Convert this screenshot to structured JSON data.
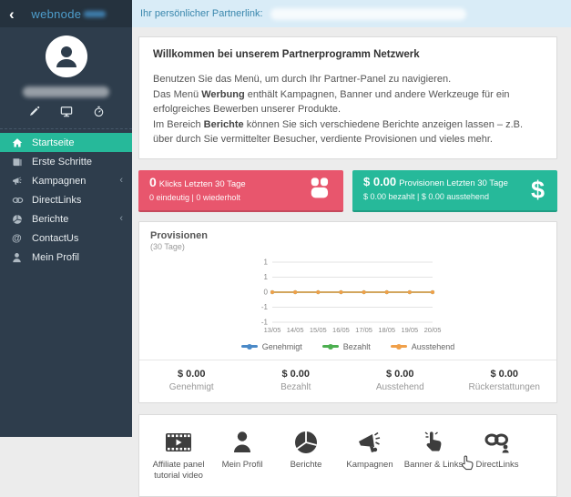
{
  "sidebar": {
    "back_arrow": "‹",
    "logo_text": "webnode",
    "menu": [
      {
        "label": "Startseite",
        "icon": "home-icon",
        "active": true
      },
      {
        "label": "Erste Schritte",
        "icon": "book-icon"
      },
      {
        "label": "Kampagnen",
        "icon": "megaphone-icon",
        "chevron": "‹"
      },
      {
        "label": "DirectLinks",
        "icon": "link-icon"
      },
      {
        "label": "Berichte",
        "icon": "pie-chart-icon",
        "chevron": "‹"
      },
      {
        "label": "ContactUs",
        "icon": "at-icon"
      },
      {
        "label": "Mein Profil",
        "icon": "user-icon"
      }
    ],
    "quick_icons": [
      "edit-pencil-icon",
      "monitor-icon",
      "stopwatch-icon"
    ],
    "colors": {
      "background": "#2e3d4c",
      "top_strip": "#25323e",
      "active_item": "#26b99a"
    }
  },
  "header": {
    "partnerlink_label": "Ihr persönlicher Partnerlink:",
    "bar_color": "#d9ecf7"
  },
  "welcome": {
    "title": "Willkommen bei unserem Partnerprogramm Netzwerk",
    "line1": "Benutzen Sie das Menü, um durch Ihr Partner-Panel zu navigieren.",
    "line2_pre": "Das Menü ",
    "line2_bold": "Werbung",
    "line2_post": " enthält Kampagnen, Banner und andere Werkzeuge für ein erfolgreiches Bewerben unserer Produkte.",
    "line3_pre": "Im Bereich ",
    "line3_bold": "Berichte",
    "line3_post": " können Sie sich verschiedene Berichte anzeigen lassen – z.B. über durch Sie vermittelter Besucher, verdiente Provisionen und vieles mehr."
  },
  "tiles": {
    "clicks": {
      "value": "0",
      "label": "Klicks Letzten 30 Tage",
      "sub": "0 eindeutig | 0 wiederholt",
      "color": "#e8566d",
      "icon": "mouse-icon"
    },
    "provisions": {
      "value": "$ 0.00",
      "label": "Provisionen Letzten 30 Tage",
      "sub": "$ 0.00 bezahlt | $ 0.00 ausstehend",
      "color": "#26b99a",
      "icon": "dollar-icon"
    }
  },
  "chart_data": {
    "type": "line",
    "title": "Provisionen",
    "subtitle": "(30 Tage)",
    "categories": [
      "13/05",
      "14/05",
      "15/05",
      "16/05",
      "17/05",
      "18/05",
      "19/05",
      "20/05"
    ],
    "series": [
      {
        "name": "Genehmigt",
        "color": "#4a89c7",
        "values": [
          0,
          0,
          0,
          0,
          0,
          0,
          0,
          0
        ]
      },
      {
        "name": "Bezahlt",
        "color": "#4caf50",
        "values": [
          0,
          0,
          0,
          0,
          0,
          0,
          0,
          0
        ]
      },
      {
        "name": "Ausstehend",
        "color": "#f0a04a",
        "values": [
          0,
          0,
          0,
          0,
          0,
          0,
          0,
          0
        ]
      }
    ],
    "y_tick_labels": [
      "1",
      "1",
      "0",
      "-1",
      "-1"
    ],
    "ylim": [
      -1,
      1
    ],
    "grid": true,
    "legend_position": "bottom"
  },
  "chart_stats": [
    {
      "value": "$ 0.00",
      "label": "Genehmigt"
    },
    {
      "value": "$ 0.00",
      "label": "Bezahlt"
    },
    {
      "value": "$ 0.00",
      "label": "Ausstehend"
    },
    {
      "value": "$ 0.00",
      "label": "Rückerstattungen"
    }
  ],
  "shortcuts": [
    {
      "label": "Affiliate panel tutorial video",
      "icon": "film-video-icon"
    },
    {
      "label": "Mein Profil",
      "icon": "user-icon"
    },
    {
      "label": "Berichte",
      "icon": "pie-chart-icon"
    },
    {
      "label": "Kampagnen",
      "icon": "megaphone-icon"
    },
    {
      "label": "Banner & Links",
      "icon": "hand-click-icon"
    },
    {
      "label": "DirectLinks",
      "icon": "chain-links-icon"
    }
  ]
}
